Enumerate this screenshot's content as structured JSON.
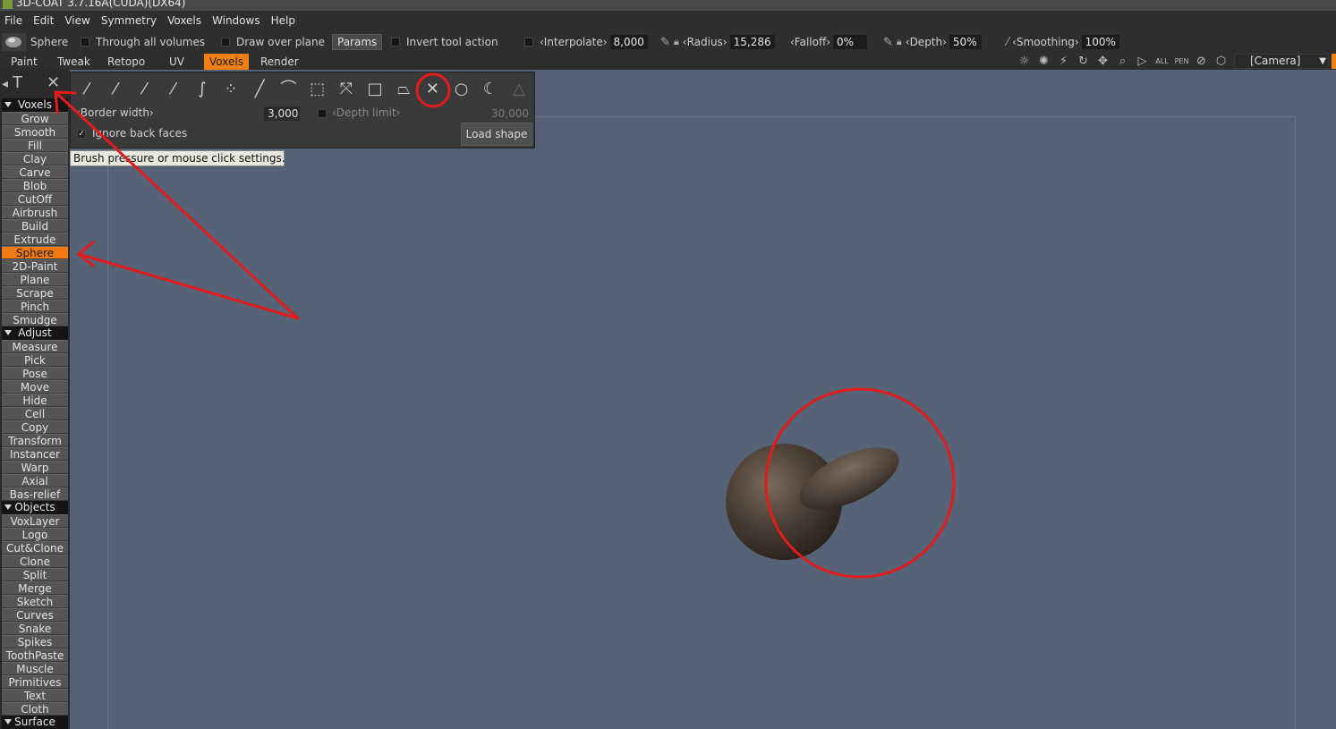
{
  "window": {
    "title": "3D-COAT 3.7.16A(CUDA)(DX64)"
  },
  "menu": [
    "File",
    "Edit",
    "View",
    "Symmetry",
    "Voxels",
    "Windows",
    "Help"
  ],
  "options": {
    "tool_name": "Sphere",
    "through_all_volumes": "Through all volumes",
    "draw_over_plane": "Draw over plane",
    "params": "Params",
    "invert_tool_action": "Invert tool action",
    "interpolate_label": "‹Interpolate›",
    "interpolate_value": "8,000",
    "radius_label": "‹Radius›",
    "radius_value": "15,286",
    "falloff_label": "‹Falloff›",
    "falloff_value": "0%",
    "depth_label": "‹Depth›",
    "depth_value": "50%",
    "smoothing_label": "‹Smoothing›",
    "smoothing_value": "100%"
  },
  "tabs": [
    "Paint",
    "Tweak",
    "Retopo",
    "UV",
    "Voxels",
    "Render"
  ],
  "active_tab": "Voxels",
  "camera": {
    "label": "[Camera]"
  },
  "popup": {
    "border_width_label": "‹Border width›",
    "border_width_value": "3,000",
    "depth_limit_label": "‹Depth limit›",
    "depth_limit_value": "30,000",
    "ignore_back_faces": "Ignore back faces",
    "load_shape": "Load shape"
  },
  "tooltip": "Brush pressure or mouse click settings.",
  "left_panel": {
    "sections": [
      {
        "name": "Voxels",
        "tools": [
          "Grow",
          "Smooth",
          "Fill",
          "Clay",
          "Carve",
          "Blob",
          "CutOff",
          "Airbrush",
          "Build",
          "Extrude",
          "Sphere",
          "2D-Paint",
          "Plane",
          "Scrape",
          "Pinch",
          "Smudge"
        ]
      },
      {
        "name": "Adjust",
        "tools": [
          "Measure",
          "Pick",
          "Pose",
          "Move",
          "Hide",
          "Cell",
          "Copy",
          "Transform",
          "Instancer",
          "Warp",
          "Axial",
          "Bas-relief"
        ]
      },
      {
        "name": "Objects",
        "tools": [
          "VoxLayer",
          "Logo",
          "Cut&Clone",
          "Clone",
          "Split",
          "Merge",
          "Sketch",
          "Curves",
          "Snake",
          "Spikes",
          "ToothPaste",
          "Muscle",
          "Primitives",
          "Text",
          "Cloth"
        ]
      },
      {
        "name": "Surface",
        "tools": []
      }
    ],
    "active_tool": "Sphere"
  },
  "colors": {
    "accent": "#f08010",
    "viewport": "#566275",
    "annotation": "#e31b1b"
  },
  "icons": {
    "stroke_modes": [
      "freehand-icon",
      "pen-icon",
      "brush-icon",
      "stroke-icon",
      "curve-brush-icon",
      "dots-icon",
      "line-icon",
      "polyline-icon",
      "spline-icon",
      "scale-arrows-icon",
      "rectangle-icon",
      "lasso-icon",
      "star-shape-icon",
      "circle-icon",
      "curve-lasso-icon",
      "triangle-icon"
    ]
  }
}
